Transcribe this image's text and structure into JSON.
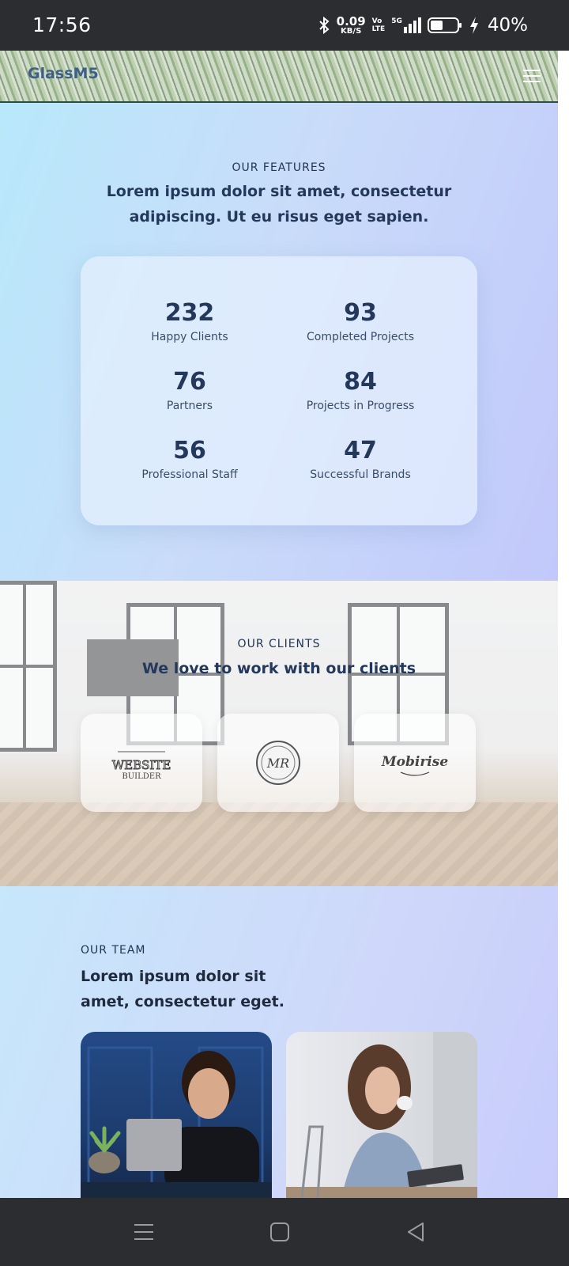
{
  "status_bar": {
    "time": "17:56",
    "net_speed_value": "0.09",
    "net_speed_unit": "KB/S",
    "volte_top": "Vo",
    "volte_bottom": "LTE",
    "network": "5G",
    "battery_percent": "40%"
  },
  "header": {
    "brand": "GlassM5"
  },
  "features": {
    "label": "OUR FEATURES",
    "heading": "Lorem ipsum dolor sit amet, consectetur adipiscing. Ut eu risus eget sapien.",
    "stats": [
      {
        "value": "232",
        "label": "Happy Clients"
      },
      {
        "value": "93",
        "label": "Completed Projects"
      },
      {
        "value": "76",
        "label": "Partners"
      },
      {
        "value": "84",
        "label": "Projects in Progress"
      },
      {
        "value": "56",
        "label": "Professional Staff"
      },
      {
        "value": "47",
        "label": "Successful Brands"
      }
    ]
  },
  "clients": {
    "label": "OUR CLIENTS",
    "heading": "We love to work with our clients",
    "logos": [
      {
        "name": "website-builder-logo",
        "text": "WEBSITE BUILDER"
      },
      {
        "name": "mr-seal-logo",
        "text": "MR"
      },
      {
        "name": "mobirise-logo",
        "text": "Mobirise"
      }
    ]
  },
  "team": {
    "label": "OUR TEAM",
    "heading": "Lorem ipsum dolor sit amet, consectetur eget."
  }
}
